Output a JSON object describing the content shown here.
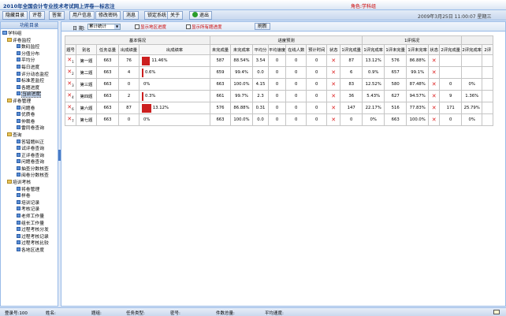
{
  "window": {
    "title": "2010年全国会计专业技术考试网上评卷—标志注",
    "role": "角色:学科组"
  },
  "menu": {
    "items": [
      "隐藏目录",
      "评卷",
      "答案",
      "用户信息",
      "修改密码",
      "消息",
      "锁定系统",
      "关于"
    ],
    "exit": "退出",
    "datetime": "2009年3月25日 11:00:07 星期三"
  },
  "sidebar": {
    "header": "功能目录",
    "tree": [
      {
        "label": "学科组",
        "level": 0,
        "type": "root"
      },
      {
        "label": "评卷监控",
        "level": 1,
        "type": "folder"
      },
      {
        "label": "数码监控",
        "level": 2,
        "type": "leaf"
      },
      {
        "label": "分值分布",
        "level": 2,
        "type": "leaf"
      },
      {
        "label": "平均分",
        "level": 2,
        "type": "leaf"
      },
      {
        "label": "每日进度",
        "level": 2,
        "type": "leaf"
      },
      {
        "label": "评分动态监控",
        "level": 2,
        "type": "leaf"
      },
      {
        "label": "标准差监控",
        "level": 2,
        "type": "leaf"
      },
      {
        "label": "各题进度",
        "level": 2,
        "type": "leaf"
      },
      {
        "label": "当前进度",
        "level": 2,
        "type": "leaf",
        "selected": true
      },
      {
        "label": "评卷管理",
        "level": 1,
        "type": "folder"
      },
      {
        "label": "问题卷",
        "level": 2,
        "type": "leaf"
      },
      {
        "label": "优质卷",
        "level": 2,
        "type": "leaf"
      },
      {
        "label": "仲裁卷",
        "level": 2,
        "type": "leaf"
      },
      {
        "label": "雷同卷查询",
        "level": 2,
        "type": "leaf"
      },
      {
        "label": "查询",
        "level": 1,
        "type": "folder"
      },
      {
        "label": "答错题纠正",
        "level": 2,
        "type": "leaf"
      },
      {
        "label": "试评卷查询",
        "level": 2,
        "type": "leaf"
      },
      {
        "label": "正评卷查询",
        "level": 2,
        "type": "leaf"
      },
      {
        "label": "问题卷查询",
        "level": 2,
        "type": "leaf"
      },
      {
        "label": "抽查分数核查",
        "level": 2,
        "type": "leaf"
      },
      {
        "label": "阅卷分数核查",
        "level": 2,
        "type": "leaf"
      },
      {
        "label": "培训考核",
        "level": 1,
        "type": "folder"
      },
      {
        "label": "将卷管理",
        "level": 2,
        "type": "leaf"
      },
      {
        "label": "样卷",
        "level": 2,
        "type": "leaf"
      },
      {
        "label": "培训记录",
        "level": 2,
        "type": "leaf"
      },
      {
        "label": "考核记录",
        "level": 2,
        "type": "leaf"
      },
      {
        "label": "老师工作量",
        "level": 2,
        "type": "leaf"
      },
      {
        "label": "组长工作量",
        "level": 2,
        "type": "leaf"
      },
      {
        "label": "过程考核分发",
        "level": 2,
        "type": "leaf"
      },
      {
        "label": "过程考核记录",
        "level": 2,
        "type": "leaf"
      },
      {
        "label": "过程考核比较",
        "level": 2,
        "type": "leaf"
      },
      {
        "label": "各地区进度",
        "level": 2,
        "type": "leaf"
      }
    ]
  },
  "toolbar": {
    "date_label": "日 期:",
    "date_value": "累计统计",
    "check1": "显示地区进度",
    "check2": "显示所有题进度",
    "refresh": "刷新"
  },
  "table": {
    "groups": [
      {
        "label": "基本情况",
        "span": 5
      },
      {
        "label": "进度预测",
        "span": 8
      },
      {
        "label": "1评情况",
        "span": 5
      },
      {
        "label": "",
        "span": 3
      }
    ],
    "columns": [
      "题号",
      "别名",
      "任务总量",
      "出成绩量",
      "出成绩率",
      "未完成量",
      "未完成率",
      "平均分",
      "平均速度",
      "在线人数",
      "预计时间",
      "状态",
      "1评完成量",
      "1评完成率",
      "1评未完量",
      "1评未完率",
      "状态",
      "2评完成量",
      "2评完成率",
      "2评"
    ],
    "rows": [
      {
        "no": "1",
        "alias": "第一题",
        "total": "663",
        "done": "76",
        "rate": "11.46%",
        "rate_val": 11.46,
        "undone": "587",
        "undone_rate": "88.54%",
        "avg": "3.54",
        "speed": "0",
        "online": "0",
        "eta": "0",
        "status": "x",
        "r1_done": "87",
        "r1_rate": "13.12%",
        "r1_undone": "576",
        "r1_undone_rate": "86.88%",
        "r1_status": "x",
        "r2_done": "",
        "r2_rate": "",
        "r2_more": ""
      },
      {
        "no": "2",
        "alias": "第二题",
        "total": "663",
        "done": "4",
        "rate": "0.6%",
        "rate_val": 0.6,
        "undone": "659",
        "undone_rate": "99.4%",
        "avg": "0.0",
        "speed": "0",
        "online": "0",
        "eta": "0",
        "status": "x",
        "r1_done": "6",
        "r1_rate": "0.9%",
        "r1_undone": "657",
        "r1_undone_rate": "99.1%",
        "r1_status": "x",
        "r2_done": "",
        "r2_rate": "",
        "r2_more": ""
      },
      {
        "no": "3",
        "alias": "第三题",
        "total": "663",
        "done": "0",
        "rate": "0%",
        "rate_val": 0,
        "undone": "663",
        "undone_rate": "100.0%",
        "avg": "4.15",
        "speed": "0",
        "online": "0",
        "eta": "0",
        "status": "x",
        "r1_done": "83",
        "r1_rate": "12.52%",
        "r1_undone": "580",
        "r1_undone_rate": "87.48%",
        "r1_status": "x",
        "r2_done": "0",
        "r2_rate": "0%",
        "r2_more": ""
      },
      {
        "no": "4",
        "alias": "第四题",
        "total": "663",
        "done": "2",
        "rate": "0.3%",
        "rate_val": 0.3,
        "undone": "661",
        "undone_rate": "99.7%",
        "avg": "2.3",
        "speed": "0",
        "online": "0",
        "eta": "0",
        "status": "x",
        "r1_done": "36",
        "r1_rate": "5.43%",
        "r1_undone": "627",
        "r1_undone_rate": "94.57%",
        "r1_status": "x",
        "r2_done": "9",
        "r2_rate": "1.36%",
        "r2_more": ""
      },
      {
        "no": "6",
        "alias": "第六题",
        "total": "663",
        "done": "87",
        "rate": "13.12%",
        "rate_val": 13.12,
        "undone": "576",
        "undone_rate": "86.88%",
        "avg": "0.31",
        "speed": "0",
        "online": "0",
        "eta": "0",
        "status": "x",
        "r1_done": "147",
        "r1_rate": "22.17%",
        "r1_undone": "516",
        "r1_undone_rate": "77.83%",
        "r1_status": "x",
        "r2_done": "171",
        "r2_rate": "25.79%",
        "r2_more": ""
      },
      {
        "no": "7",
        "alias": "第七题",
        "total": "663",
        "done": "0",
        "rate": "0%",
        "rate_val": 0,
        "undone": "663",
        "undone_rate": "100.0%",
        "avg": "0.0",
        "speed": "0",
        "online": "0",
        "eta": "0",
        "status": "x",
        "r1_done": "0",
        "r1_rate": "0%",
        "r1_undone": "663",
        "r1_undone_rate": "100.0%",
        "r1_status": "x",
        "r2_done": "0",
        "r2_rate": "0%",
        "r2_more": ""
      }
    ]
  },
  "statusbar": {
    "login_count": "登录号:100",
    "name": "姓名:",
    "question": "题组:",
    "task_type": "任务类型:",
    "password": "密号:",
    "pieces": "件数总量:",
    "avg_speed": "平均速度:"
  }
}
